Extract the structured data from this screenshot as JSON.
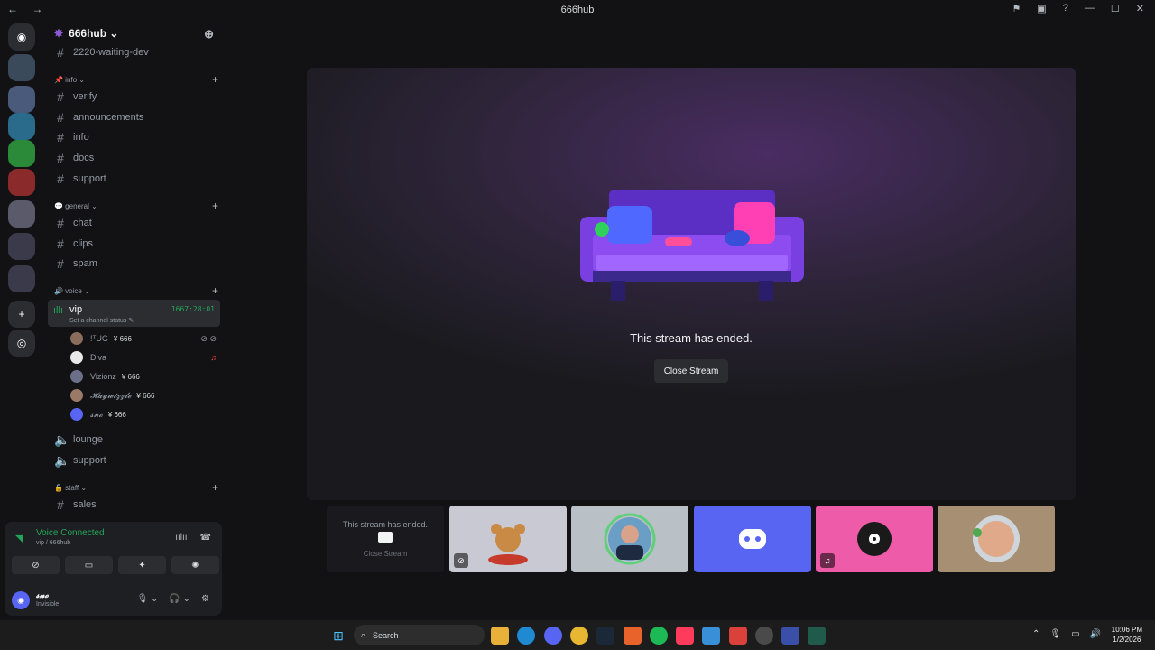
{
  "window": {
    "title": "666hub",
    "nav": "← →"
  },
  "server_header": {
    "name": "666hub ⌄"
  },
  "channels": {
    "top_partial": "2220-waiting-dev",
    "info_category": "📌 info ⌄",
    "info_items": [
      "verify",
      "announcements",
      "info",
      "docs",
      "support"
    ],
    "general_category": "💬 general ⌄",
    "general_items": [
      "chat",
      "clips",
      "spam"
    ],
    "voice_category": "🔊 voice ⌄",
    "vip": {
      "name": "vip",
      "status": "Set a channel status ✎",
      "timer": "1667:28:01"
    },
    "voice_users": [
      {
        "name": "!ᵀUG",
        "tag": "¥ 666",
        "avatar_color": "#8a6d5a"
      },
      {
        "name": "Diva",
        "tag": "",
        "avatar_color": "#e8e8e8"
      },
      {
        "name": "Vizionz",
        "tag": "¥ 666",
        "avatar_color": "#6b6f8a"
      },
      {
        "name": "𝓗𝓪𝔂𝔀𝓲𝔃𝔃𝓵𝓮",
        "tag": "¥ 666",
        "avatar_color": "#9a7a66"
      },
      {
        "name": "𝓼𝓷𝓸",
        "tag": "¥ 666",
        "avatar_color": "#5865f2"
      }
    ],
    "other_voice": [
      "lounge",
      "support"
    ],
    "staff_category": "🔒 staff ⌄",
    "staff_items": [
      "sales"
    ]
  },
  "voice_panel": {
    "status": "Voice Connected",
    "sub": "vip / 666hub",
    "username": "𝓼𝓷𝓸",
    "user_status": "Invisible"
  },
  "stage": {
    "ended_text": "This stream has ended.",
    "close_button": "Close Stream"
  },
  "thumbnails": {
    "first_text": "This stream has ended.",
    "first_button": "Close Stream",
    "colors": [
      "#1a1a1e",
      "#c9c9d3",
      "#b9c0c6",
      "#5865f2",
      "#ee5ba8",
      "#a68f73"
    ]
  },
  "taskbar": {
    "search_placeholder": "Search",
    "time": "10:06 PM",
    "date": "1/2/2026"
  }
}
